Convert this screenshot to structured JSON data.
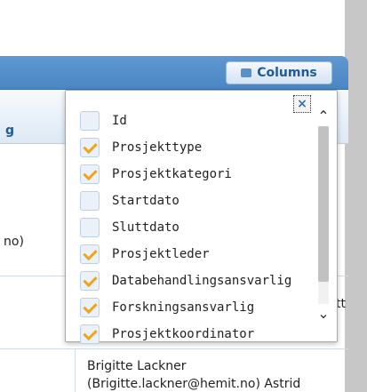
{
  "toolbar": {
    "columns_label": "Columns"
  },
  "grid": {
    "header_fragment": "g",
    "left_fragment": "no)",
    "right_fragment": "tt",
    "row_person": "Brigitte Lackner",
    "row_email": "(Brigitte.lackner@hemit.no) Astrid"
  },
  "menu": {
    "close_glyph": "×",
    "items": [
      {
        "label": "Id",
        "checked": false
      },
      {
        "label": "Prosjekttype",
        "checked": true
      },
      {
        "label": "Prosjektkategori",
        "checked": true
      },
      {
        "label": "Startdato",
        "checked": false
      },
      {
        "label": "Sluttdato",
        "checked": false
      },
      {
        "label": "Prosjektleder",
        "checked": true
      },
      {
        "label": "Databehandlingsansvarlig",
        "checked": true
      },
      {
        "label": "Forskningsansvarlig",
        "checked": true
      },
      {
        "label": "Prosjektkoordinator",
        "checked": true
      }
    ]
  },
  "icons": {
    "columns": "grid-icon",
    "close": "close-icon",
    "up": "chevron-up-icon",
    "down": "chevron-down-icon"
  },
  "colors": {
    "accent": "#4a86c3",
    "check": "#f0a41a"
  }
}
